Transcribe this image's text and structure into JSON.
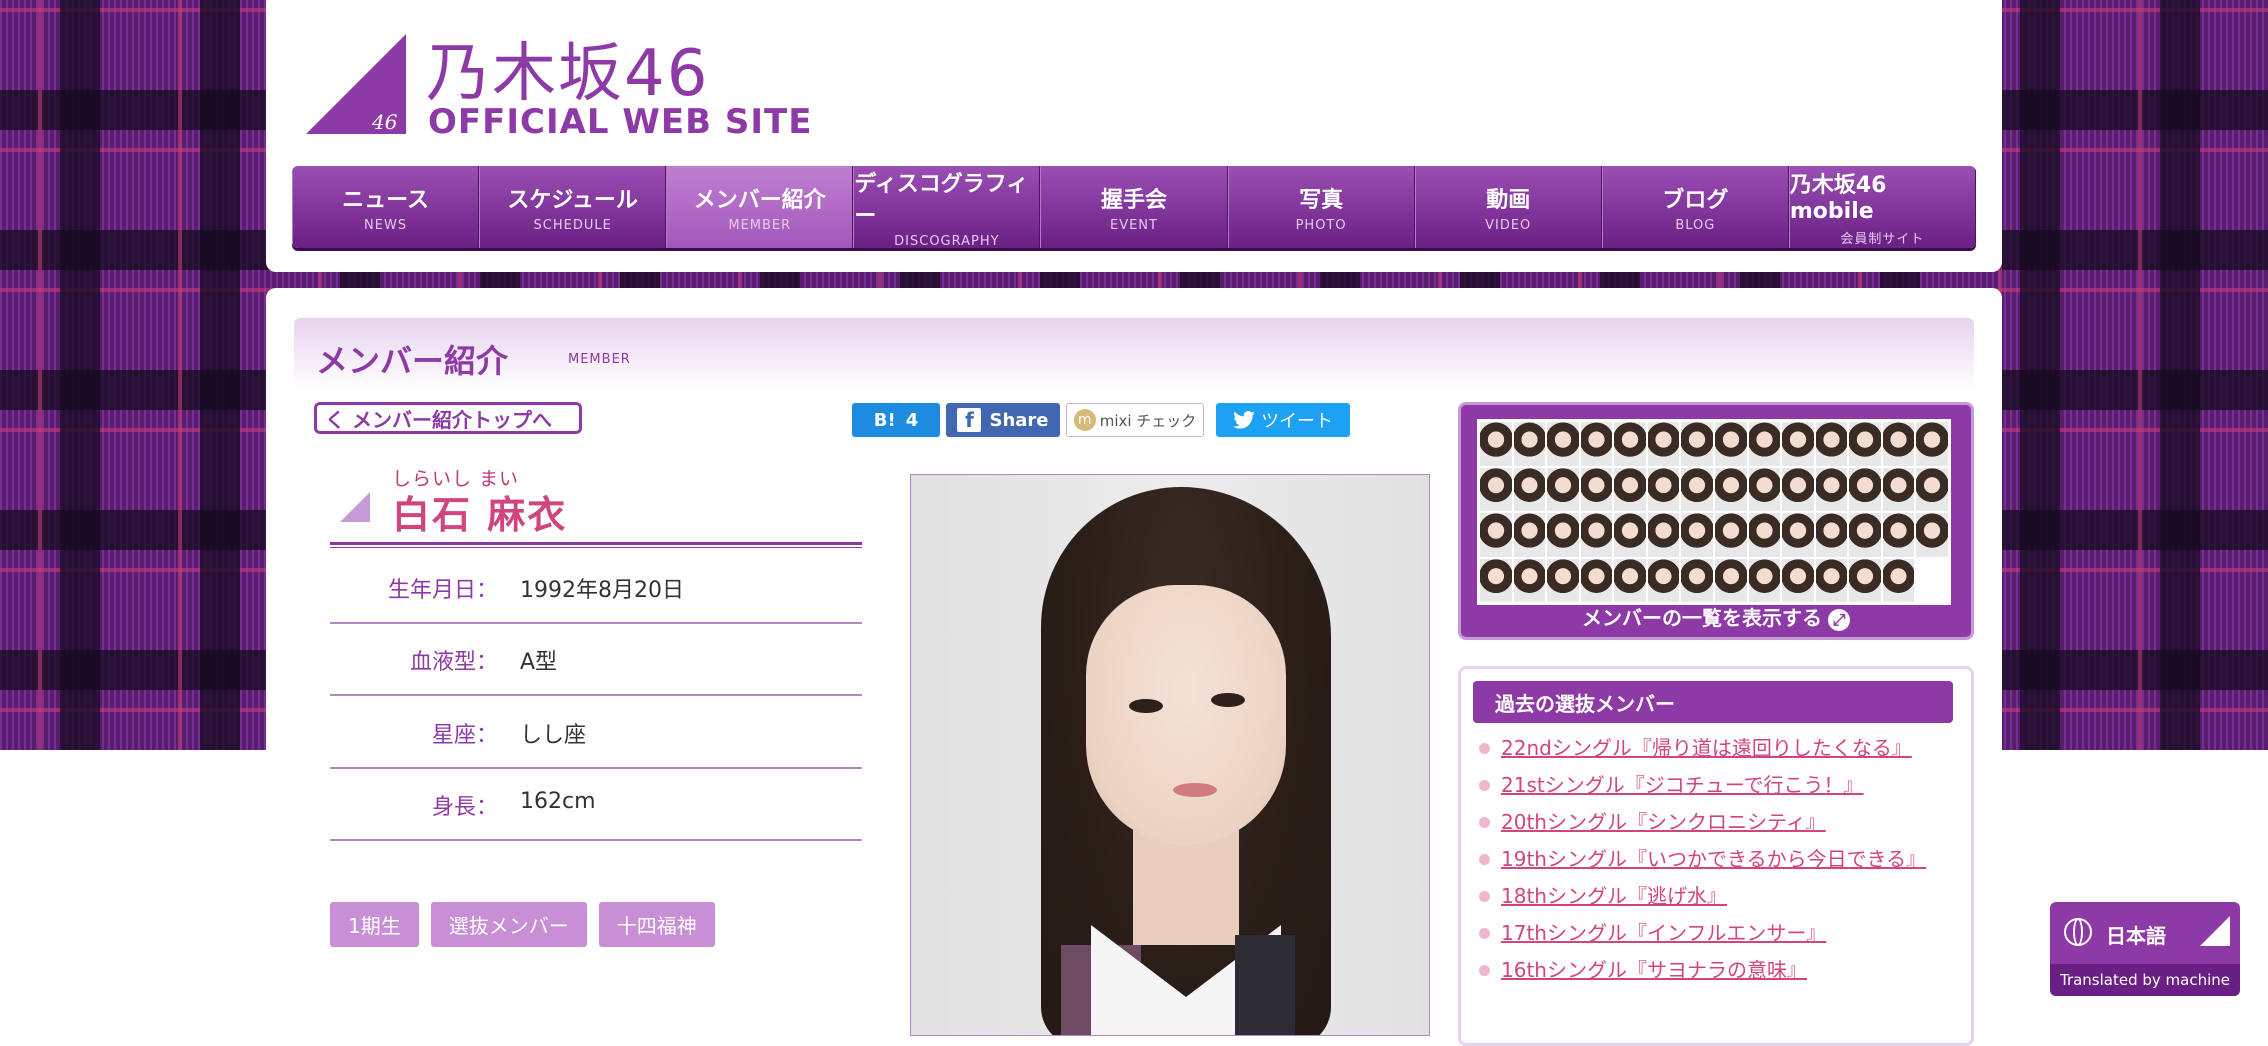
{
  "brand": {
    "logo_jp": "乃木坂46",
    "logo_en": "OFFICIAL WEB SITE",
    "logo_mark": "46",
    "color": "#8e3aa6"
  },
  "nav": [
    {
      "jp": "ニュース",
      "en": "NEWS",
      "active": false
    },
    {
      "jp": "スケジュール",
      "en": "SCHEDULE",
      "active": false
    },
    {
      "jp": "メンバー紹介",
      "en": "MEMBER",
      "active": true
    },
    {
      "jp": "ディスコグラフィー",
      "en": "DISCOGRAPHY",
      "active": false
    },
    {
      "jp": "握手会",
      "en": "EVENT",
      "active": false
    },
    {
      "jp": "写真",
      "en": "PHOTO",
      "active": false
    },
    {
      "jp": "動画",
      "en": "VIDEO",
      "active": false
    },
    {
      "jp": "ブログ",
      "en": "BLOG",
      "active": false
    },
    {
      "jp": "乃木坂46 mobile",
      "en": "会員制サイト",
      "active": false
    }
  ],
  "section": {
    "title": "メンバー紹介",
    "sub": "MEMBER"
  },
  "back_link": "く メンバー紹介トップへ",
  "share": {
    "hatena_label": "B!",
    "hatena_count": "4",
    "facebook": "Share",
    "mixi": "mixi チェック",
    "twitter": "ツイート"
  },
  "profile": {
    "furigana": "しらいし まい",
    "name": "白石 麻衣",
    "fields": [
      {
        "label": "生年月日：",
        "value": "1992年8月20日"
      },
      {
        "label": "血液型：",
        "value": "A型"
      },
      {
        "label": "星座：",
        "value": "しし座"
      },
      {
        "label": "身長：",
        "value": "162cm"
      }
    ],
    "tags": [
      "1期生",
      "選抜メンバー",
      "十四福神"
    ]
  },
  "sidebar": {
    "show_all": "メンバーの一覧を表示する",
    "past_heading": "過去の選抜メンバー",
    "singles": [
      "22ndシングル『帰り道は遠回りしたくなる』",
      "21stシングル『ジコチューで行こう！』",
      "20thシングル『シンクロニシティ』",
      "19thシングル『いつかできるから今日できる』",
      "18thシングル『逃げ水』",
      "17thシングル『インフルエンサー』",
      "16thシングル『サヨナラの意味』"
    ]
  },
  "translate": {
    "lang": "日本語",
    "note": "Translated by machine"
  }
}
